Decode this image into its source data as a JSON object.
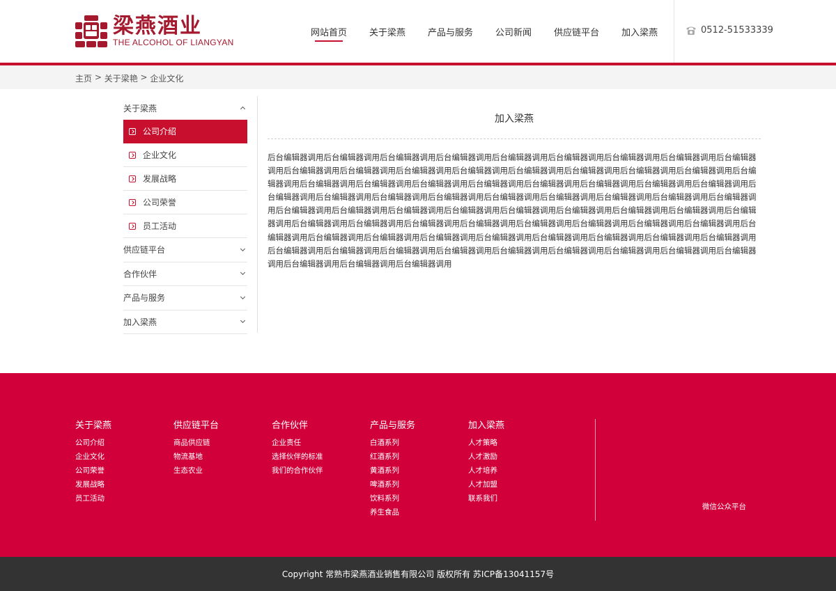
{
  "brand": {
    "name_cn": "梁燕酒业",
    "name_en": "THE ALCOHOL OF LIANGYAN",
    "color": "#c8102e"
  },
  "nav": {
    "items": [
      {
        "label": "网站首页",
        "active": true
      },
      {
        "label": "关于梁燕"
      },
      {
        "label": "产品与服务"
      },
      {
        "label": "公司新闻"
      },
      {
        "label": "供应链平台"
      },
      {
        "label": "加入梁燕"
      }
    ],
    "phone": "0512-51533339",
    "phone_icon": "phone-icon"
  },
  "breadcrumb": {
    "home": "主页",
    "sep": " > ",
    "parent": "关于梁艳",
    "current": "企业文化"
  },
  "sidebar": {
    "group_title": "关于梁燕",
    "sub_items": [
      {
        "label": "公司介绍",
        "active": true
      },
      {
        "label": "企业文化"
      },
      {
        "label": "发展战略"
      },
      {
        "label": "公司荣誉"
      },
      {
        "label": "员工活动"
      }
    ],
    "categories": [
      "供应链平台",
      "合作伙伴",
      "产品与服务",
      "加入梁燕"
    ]
  },
  "content": {
    "title": "加入梁燕",
    "body": "后台编辑器调用后台编辑器调用后台编辑器调用后台编辑器调用后台编辑器调用后台编辑器调用后台编辑器调用后台编辑器调用后台编辑器调用后台编辑器调用后台编辑器调用后台编辑器调用后台编辑器调用后台编辑器调用后台编辑器调用后台编辑器调用后台编辑器调用后台编辑器调用后台编辑器调用后台编辑器调用后台编辑器调用后台编辑器调用后台编辑器调用后台编辑器调用后台编辑器调用后台编辑器调用后台编辑器调用后台编辑器调用后台编辑器调用后台编辑器调用后台编辑器调用后台编辑器调用后台编辑器调用后台编辑器调用后台编辑器调用后台编辑器调用后台编辑器调用后台编辑器调用后台编辑器调用后台编辑器调用后台编辑器调用后台编辑器调用后台编辑器调用后台编辑器调用后台编辑器调用后台编辑器调用后台编辑器调用后台编辑器调用后台编辑器调用后台编辑器调用后台编辑器调用后台编辑器调用后台编辑器调用后台编辑器调用后台编辑器调用后台编辑器调用后台编辑器调用后台编辑器调用后台编辑器调用后台编辑器调用后台编辑器调用后台编辑器调用后台编辑器调用后台编辑器调用后台编辑器调用后台编辑器调用后台编辑器调用后台编辑器调用后台编辑器调用后台编辑器调用后台编辑器调用后台编辑器调用后台编辑器调用"
  },
  "footer": {
    "columns": [
      {
        "title": "关于梁燕",
        "links": [
          "公司介绍",
          "企业文化",
          "公司荣誉",
          "发展战略",
          "员工活动"
        ]
      },
      {
        "title": "供应链平台",
        "links": [
          "商品供应链",
          "物流基地",
          "生态农业"
        ]
      },
      {
        "title": "合作伙伴",
        "links": [
          "企业责任",
          "选择伙伴的标准",
          "我们的合作伙伴"
        ]
      },
      {
        "title": "产品与服务",
        "links": [
          "白酒系列",
          "红酒系列",
          "黄酒系列",
          "啤酒系列",
          "饮料系列",
          "养生食品"
        ]
      },
      {
        "title": "加入梁燕",
        "links": [
          "人才策略",
          "人才激励",
          "人才培养",
          "人才加盟",
          "联系我们"
        ]
      }
    ],
    "wechat_label": "微信公众平台",
    "copyright": "Copyright 常熟市梁燕酒业销售有限公司 版权所有 苏ICP备13041157号",
    "color": "#d2003a"
  }
}
